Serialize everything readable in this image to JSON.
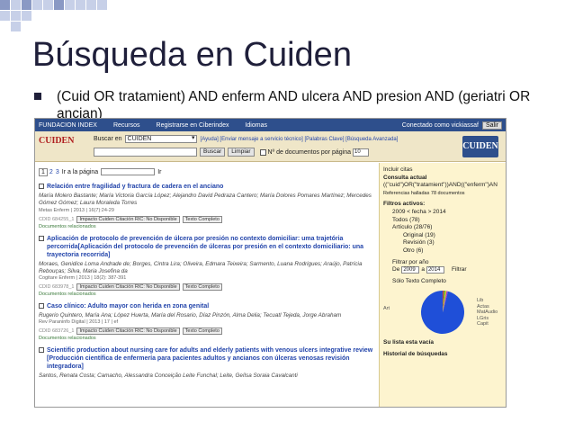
{
  "slide": {
    "title": "Búsqueda en Cuiden",
    "bullet": "(Cuid OR tratamient) AND enferm AND ulcera AND presion AND (geriatri OR ancian)"
  },
  "colors": {
    "accent": "#2e4f8c",
    "deco_light": "#c7d0e8",
    "deco_dark": "#8a99c4"
  },
  "topbar": {
    "items": [
      "FUNDACION INDEX",
      "Recursos",
      "Registrarse en Ciberindex",
      "Idiomas"
    ],
    "status": "Conectado como vickiassaf",
    "logout": "Salir"
  },
  "header": {
    "logo_text": "CUIDEN",
    "logo_right": "CUIDEN",
    "search_in_label": "Buscar en",
    "search_in_value": "CUIDEN",
    "links": "[Ayuda] [Enviar mensaje a servicio técnico] [Palabras Clave] [Búsqueda Avanzada]",
    "search_button": "Buscar",
    "clear_button": "Limpiar",
    "docs_per_page_label": "Nº de documentos por página",
    "docs_per_page_value": "10"
  },
  "pager": {
    "current": "1",
    "pages": [
      "2",
      "3"
    ],
    "goto_label": "Ir a la página",
    "go_button": "Ir"
  },
  "results": [
    {
      "title": "Relación entre fragilidad y fractura de cadera en el anciano",
      "authors": "María Molero Bastante; María Victoria García López; Alejandro David Pedraza Cantero; María Dolores Pomares Martínez; Mercedes Gómez Gómez; Laura Moraleda Torres",
      "source": "Metas Enferm | 2013 | 16(7):24-29",
      "cuid_id": "CDID 684255_1",
      "tags": [
        "Impacto Cuiden Citación RIC: No Disponible",
        "Texto Completo"
      ],
      "related": "Documentos relacionados"
    },
    {
      "title": "Aplicación de protocolo de prevención de úlcera por presión no contexto domiciliar: uma trajetória percorrida[Aplicación del protocolo de prevención de úlceras por presión en el contexto domiciliario: una trayectoria recorrida]",
      "authors": "Moraes, Genidice Loma Andrade de; Borges, Cintra Lira; Oliveira, Edmara Teixeira; Sarmento, Luana Rodrigues; Araújo, Patrícia Rebouças; Silva, Maria Josefina da",
      "source": "Cogitare Enferm | 2013 | 18(2): 387-391",
      "cuid_id": "CDID 683978_1",
      "tags": [
        "Impacto Cuiden Citación RIC: No Disponible",
        "Texto Completo"
      ],
      "related": "Documentos relacionados"
    },
    {
      "title": "Caso clínico: Adulto mayor con herida en zona genital",
      "authors": "Rugerio Quintero, María Ana; López Huerta, María del Rosario, Díaz Pinzón, Alma Delia; Tecuatl Tejeda, Jorge Abraham",
      "source": "Rev Paraninfo Digital | 2013 | 17 | ef",
      "cuid_id": "CDID 683726_1",
      "tags": [
        "Impacto Cuiden Citación RIC: No Disponible",
        "Texto Completo"
      ],
      "related": "Documentos relacionados"
    },
    {
      "title": "Scientific production about nursing care for adults and elderly patients with venous ulcers integrative review [Producción científica de enfermería para pacientes adultos y ancianos con úlceras venosas revisión integradora]",
      "authors": "Santos, Renata Costa; Camacho, Alessandra Conceição Leite Funchal; Leite, Geílsa Soraia Cavalcanti",
      "source": "",
      "cuid_id": "",
      "tags": [],
      "related": ""
    }
  ],
  "sidebar": {
    "include_quotes": "Incluir citas",
    "current_query_label": "Consulta actual",
    "current_query": "((\"cuid\")OR(\"tratamient\"))AND((\"enferm\")AN",
    "refs_found": "Referencias halladas 78 documentos",
    "active_filters_label": "Filtros activos:",
    "active_filter": "2009 < fecha > 2014",
    "filters": [
      {
        "label": "Todos (78)",
        "level": 1
      },
      {
        "label": "Artículo (28/76)",
        "level": 1
      },
      {
        "label": "Original (19)",
        "level": 2
      },
      {
        "label": "Revisión (3)",
        "level": 2
      },
      {
        "label": "Otro (6)",
        "level": 2
      }
    ],
    "filter_year_label": "Filtrar por año",
    "year_from_label": "De",
    "year_from": "2009",
    "year_to_label": "a",
    "year_to": "2014",
    "filter_button": "Filtrar",
    "fulltext_label": "Sólo Texto Completo",
    "pie_labels": [
      "Art",
      "Lib",
      "Actas",
      "MatAudio",
      "LGris",
      "Capit"
    ],
    "pie_values": [
      96,
      1,
      1,
      1,
      1
    ],
    "empty_list": "Su lista esta vacía",
    "history": "Historial de búsquedas"
  }
}
